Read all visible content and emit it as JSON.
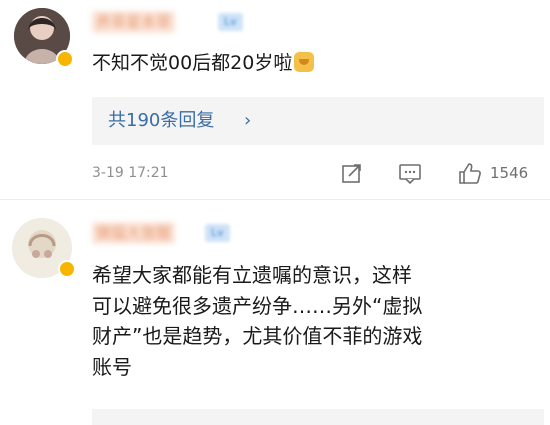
{
  "comments": [
    {
      "username": "养草星本草",
      "level": "Lv",
      "text": "不知不觉00后都20岁啦",
      "emoji": "dog-emoji",
      "replies": "共190条回复",
      "reply_chevron": "›",
      "timestamp": "3-19 17:21",
      "likes": "1546"
    },
    {
      "username": "懒猫大曾醒",
      "level": "Lv",
      "text_lines": [
        "希望大家都能有立遗嘱的意识，这样",
        "可以避免很多遗产纷争……另外“虚拟",
        "财产”也是趋势，尤其价值不菲的游戏",
        "账号"
      ]
    }
  ],
  "icons": {
    "share": "share-icon",
    "comment": "comment-icon",
    "like": "thumbs-up-icon"
  },
  "colors": {
    "link": "#3a6da8",
    "meta": "#8f8f8f",
    "reply_bg": "#f4f4f4"
  }
}
